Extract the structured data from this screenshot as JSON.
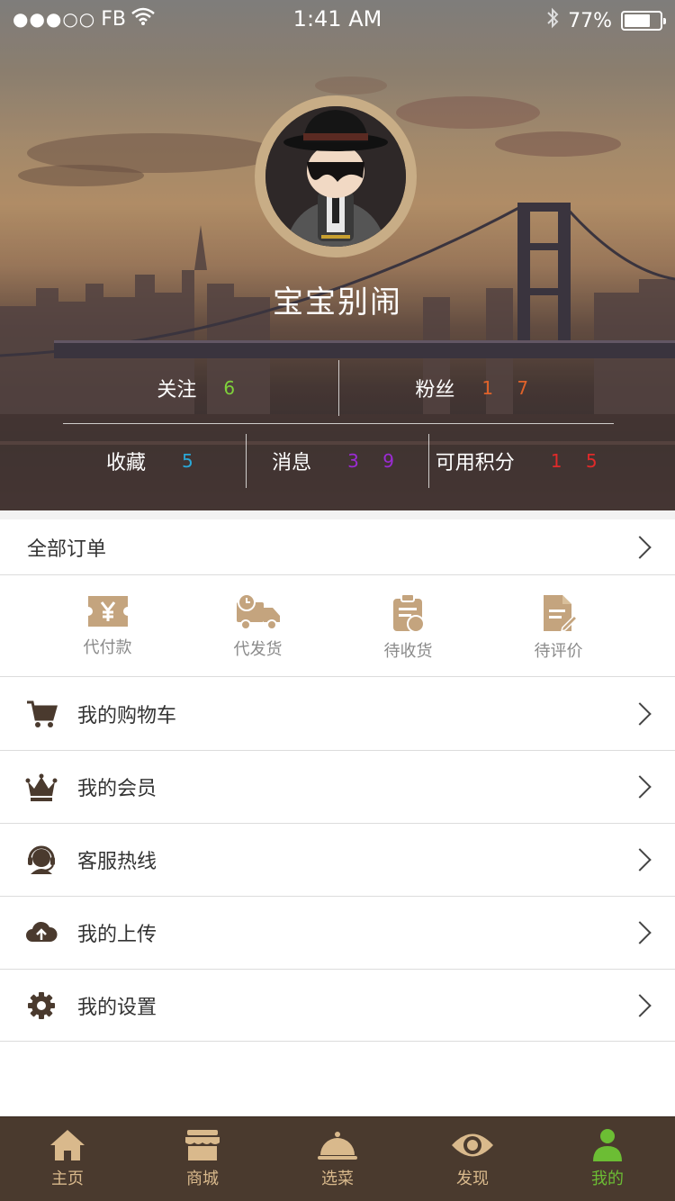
{
  "status_bar": {
    "carrier": "FB",
    "signal_dots": "●●●○○",
    "time": "1:41 AM",
    "battery_percent": "77%",
    "battery_level": 0.77
  },
  "profile": {
    "username": "宝宝别闹"
  },
  "stats": {
    "follow": {
      "label": "关注",
      "value": "6",
      "color": "#7fd23b"
    },
    "fans": {
      "label": "粉丝",
      "value": "1 7",
      "color": "#e0622a"
    },
    "favorites": {
      "label": "收藏",
      "value": "5",
      "color": "#2aa8d8"
    },
    "messages": {
      "label": "消息",
      "value": "3 9",
      "color": "#9b2bd4"
    },
    "points": {
      "label": "可用积分",
      "value": "1 5",
      "color": "#e02a2a"
    }
  },
  "orders": {
    "title": "全部订单",
    "items": [
      {
        "label": "代付款",
        "icon": "ticket-yuan-icon"
      },
      {
        "label": "代发货",
        "icon": "truck-clock-icon"
      },
      {
        "label": "待收货",
        "icon": "clipboard-receive-icon"
      },
      {
        "label": "待评价",
        "icon": "document-edit-icon"
      }
    ]
  },
  "menu": [
    {
      "label": "我的购物车",
      "icon": "cart-icon"
    },
    {
      "label": "我的会员",
      "icon": "crown-icon"
    },
    {
      "label": "客服热线",
      "icon": "headset-icon"
    },
    {
      "label": "我的上传",
      "icon": "cloud-upload-icon"
    },
    {
      "label": "我的设置",
      "icon": "gear-icon"
    }
  ],
  "tabs": [
    {
      "label": "主页",
      "icon": "home-icon"
    },
    {
      "label": "商城",
      "icon": "store-icon"
    },
    {
      "label": "选菜",
      "icon": "dish-cover-icon"
    },
    {
      "label": "发现",
      "icon": "eye-icon"
    },
    {
      "label": "我的",
      "icon": "person-icon",
      "active": true
    }
  ],
  "colors": {
    "accent_icon": "#c4a47e",
    "menu_icon": "#4a3a2e",
    "tabbar_bg": "#4a3a2e",
    "tab_label": "#d9b98c",
    "tab_active": "#6cbd34"
  }
}
